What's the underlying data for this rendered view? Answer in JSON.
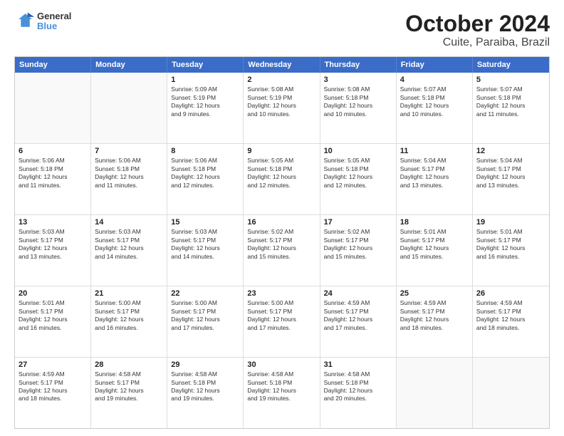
{
  "logo": {
    "line1": "General",
    "line2": "Blue"
  },
  "title": "October 2024",
  "subtitle": "Cuite, Paraiba, Brazil",
  "days": [
    "Sunday",
    "Monday",
    "Tuesday",
    "Wednesday",
    "Thursday",
    "Friday",
    "Saturday"
  ],
  "weeks": [
    [
      {
        "day": "",
        "info": ""
      },
      {
        "day": "",
        "info": ""
      },
      {
        "day": "1",
        "info": "Sunrise: 5:09 AM\nSunset: 5:19 PM\nDaylight: 12 hours\nand 9 minutes."
      },
      {
        "day": "2",
        "info": "Sunrise: 5:08 AM\nSunset: 5:19 PM\nDaylight: 12 hours\nand 10 minutes."
      },
      {
        "day": "3",
        "info": "Sunrise: 5:08 AM\nSunset: 5:18 PM\nDaylight: 12 hours\nand 10 minutes."
      },
      {
        "day": "4",
        "info": "Sunrise: 5:07 AM\nSunset: 5:18 PM\nDaylight: 12 hours\nand 10 minutes."
      },
      {
        "day": "5",
        "info": "Sunrise: 5:07 AM\nSunset: 5:18 PM\nDaylight: 12 hours\nand 11 minutes."
      }
    ],
    [
      {
        "day": "6",
        "info": "Sunrise: 5:06 AM\nSunset: 5:18 PM\nDaylight: 12 hours\nand 11 minutes."
      },
      {
        "day": "7",
        "info": "Sunrise: 5:06 AM\nSunset: 5:18 PM\nDaylight: 12 hours\nand 11 minutes."
      },
      {
        "day": "8",
        "info": "Sunrise: 5:06 AM\nSunset: 5:18 PM\nDaylight: 12 hours\nand 12 minutes."
      },
      {
        "day": "9",
        "info": "Sunrise: 5:05 AM\nSunset: 5:18 PM\nDaylight: 12 hours\nand 12 minutes."
      },
      {
        "day": "10",
        "info": "Sunrise: 5:05 AM\nSunset: 5:18 PM\nDaylight: 12 hours\nand 12 minutes."
      },
      {
        "day": "11",
        "info": "Sunrise: 5:04 AM\nSunset: 5:17 PM\nDaylight: 12 hours\nand 13 minutes."
      },
      {
        "day": "12",
        "info": "Sunrise: 5:04 AM\nSunset: 5:17 PM\nDaylight: 12 hours\nand 13 minutes."
      }
    ],
    [
      {
        "day": "13",
        "info": "Sunrise: 5:03 AM\nSunset: 5:17 PM\nDaylight: 12 hours\nand 13 minutes."
      },
      {
        "day": "14",
        "info": "Sunrise: 5:03 AM\nSunset: 5:17 PM\nDaylight: 12 hours\nand 14 minutes."
      },
      {
        "day": "15",
        "info": "Sunrise: 5:03 AM\nSunset: 5:17 PM\nDaylight: 12 hours\nand 14 minutes."
      },
      {
        "day": "16",
        "info": "Sunrise: 5:02 AM\nSunset: 5:17 PM\nDaylight: 12 hours\nand 15 minutes."
      },
      {
        "day": "17",
        "info": "Sunrise: 5:02 AM\nSunset: 5:17 PM\nDaylight: 12 hours\nand 15 minutes."
      },
      {
        "day": "18",
        "info": "Sunrise: 5:01 AM\nSunset: 5:17 PM\nDaylight: 12 hours\nand 15 minutes."
      },
      {
        "day": "19",
        "info": "Sunrise: 5:01 AM\nSunset: 5:17 PM\nDaylight: 12 hours\nand 16 minutes."
      }
    ],
    [
      {
        "day": "20",
        "info": "Sunrise: 5:01 AM\nSunset: 5:17 PM\nDaylight: 12 hours\nand 16 minutes."
      },
      {
        "day": "21",
        "info": "Sunrise: 5:00 AM\nSunset: 5:17 PM\nDaylight: 12 hours\nand 16 minutes."
      },
      {
        "day": "22",
        "info": "Sunrise: 5:00 AM\nSunset: 5:17 PM\nDaylight: 12 hours\nand 17 minutes."
      },
      {
        "day": "23",
        "info": "Sunrise: 5:00 AM\nSunset: 5:17 PM\nDaylight: 12 hours\nand 17 minutes."
      },
      {
        "day": "24",
        "info": "Sunrise: 4:59 AM\nSunset: 5:17 PM\nDaylight: 12 hours\nand 17 minutes."
      },
      {
        "day": "25",
        "info": "Sunrise: 4:59 AM\nSunset: 5:17 PM\nDaylight: 12 hours\nand 18 minutes."
      },
      {
        "day": "26",
        "info": "Sunrise: 4:59 AM\nSunset: 5:17 PM\nDaylight: 12 hours\nand 18 minutes."
      }
    ],
    [
      {
        "day": "27",
        "info": "Sunrise: 4:59 AM\nSunset: 5:17 PM\nDaylight: 12 hours\nand 18 minutes."
      },
      {
        "day": "28",
        "info": "Sunrise: 4:58 AM\nSunset: 5:17 PM\nDaylight: 12 hours\nand 19 minutes."
      },
      {
        "day": "29",
        "info": "Sunrise: 4:58 AM\nSunset: 5:18 PM\nDaylight: 12 hours\nand 19 minutes."
      },
      {
        "day": "30",
        "info": "Sunrise: 4:58 AM\nSunset: 5:18 PM\nDaylight: 12 hours\nand 19 minutes."
      },
      {
        "day": "31",
        "info": "Sunrise: 4:58 AM\nSunset: 5:18 PM\nDaylight: 12 hours\nand 20 minutes."
      },
      {
        "day": "",
        "info": ""
      },
      {
        "day": "",
        "info": ""
      }
    ]
  ]
}
